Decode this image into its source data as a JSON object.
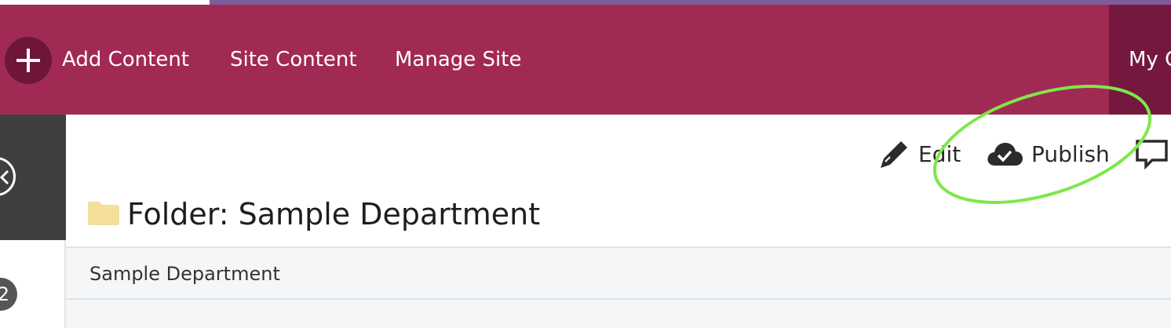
{
  "topbar": {
    "add_content": "Add Content",
    "site_content": "Site Content",
    "manage_site": "Manage Site",
    "my_partial": "My C"
  },
  "sidebar": {
    "badge_count": "2"
  },
  "actions": {
    "edit": "Edit",
    "publish": "Publish"
  },
  "page": {
    "title": "Folder: Sample Department",
    "breadcrumb": "Sample Department"
  },
  "colors": {
    "topbar": "#a12a55",
    "topbar_dark": "#74183f",
    "annotation": "#7ee84a"
  },
  "icons": [
    "plus-icon",
    "chevron-left-icon",
    "pencil-icon",
    "cloud-check-icon",
    "comment-icon",
    "folder-icon"
  ]
}
